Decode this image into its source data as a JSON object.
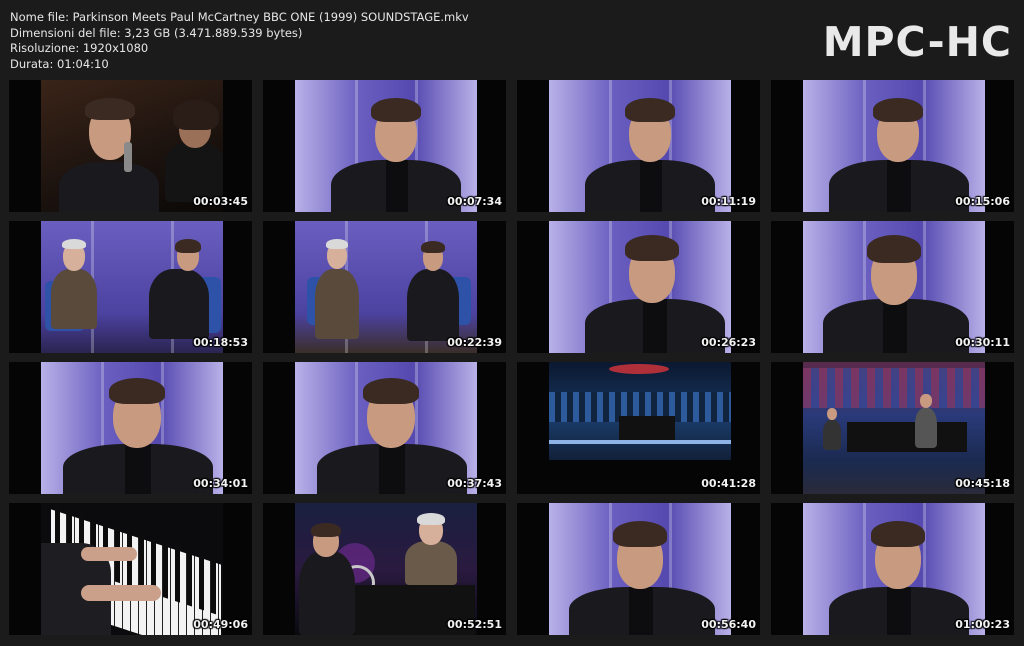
{
  "app": {
    "logo": "MPC-HC"
  },
  "file_info": {
    "name_line": "Nome file: Parkinson Meets Paul McCartney BBC ONE (1999) SOUNDSTAGE.mkv",
    "size_line": "Dimensioni del file: 3,23 GB (3.471.889.539 bytes)",
    "resolution_line": "Risoluzione: 1920x1080",
    "duration_line": "Durata: 01:04:10"
  },
  "thumbnails": [
    {
      "timestamp": "00:03:45"
    },
    {
      "timestamp": "00:07:34"
    },
    {
      "timestamp": "00:11:19"
    },
    {
      "timestamp": "00:15:06"
    },
    {
      "timestamp": "00:18:53"
    },
    {
      "timestamp": "00:22:39"
    },
    {
      "timestamp": "00:26:23"
    },
    {
      "timestamp": "00:30:11"
    },
    {
      "timestamp": "00:34:01"
    },
    {
      "timestamp": "00:37:43"
    },
    {
      "timestamp": "00:41:28"
    },
    {
      "timestamp": "00:45:18"
    },
    {
      "timestamp": "00:49:06"
    },
    {
      "timestamp": "00:52:51"
    },
    {
      "timestamp": "00:56:40"
    },
    {
      "timestamp": "01:00:23"
    }
  ],
  "colors": {
    "background": "#1b1b1b",
    "studio_purple": "#6a5fc0",
    "studio_light": "#b8b0e6"
  }
}
